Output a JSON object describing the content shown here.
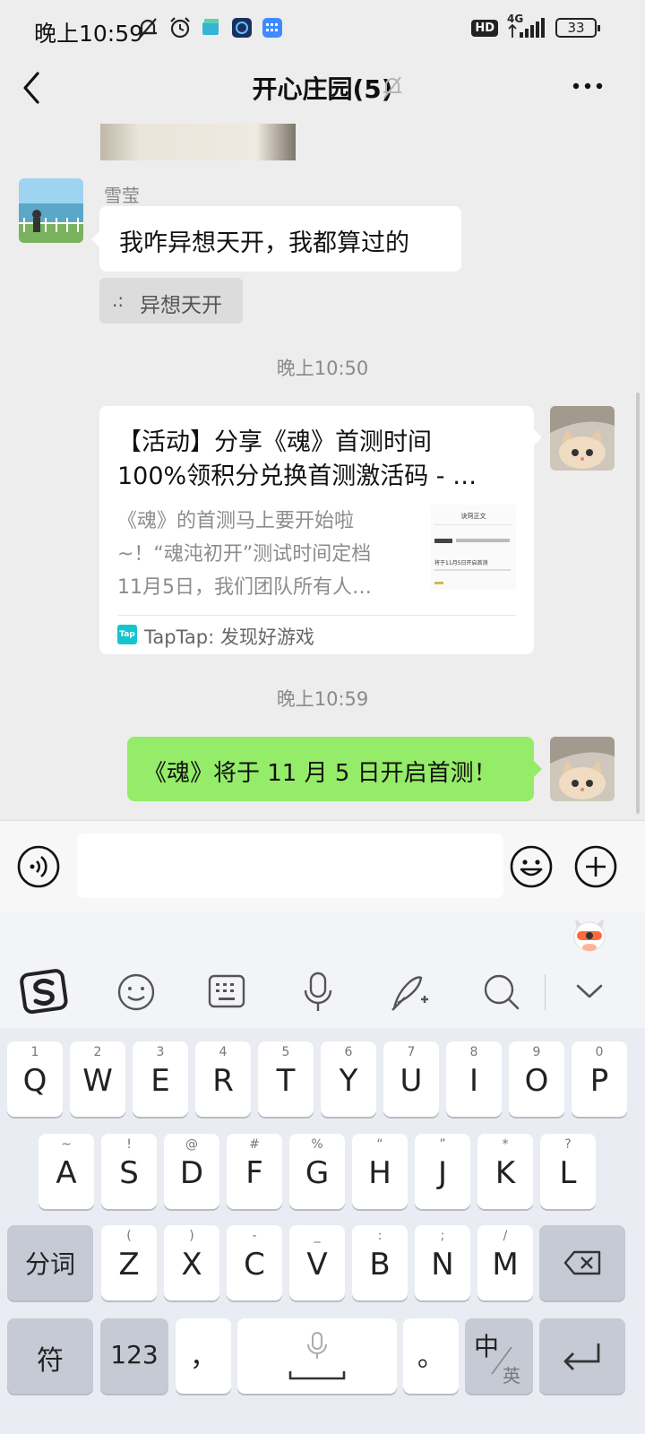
{
  "status_bar": {
    "time": "晚上10:59",
    "network": "4G",
    "hd": "HD",
    "battery": "33"
  },
  "nav": {
    "title": "开心庄园(5)"
  },
  "messages": {
    "sender_name": "雪莹",
    "text1": "我咋异想天开，我都算过的",
    "quote_prefix": ".:",
    "quote_text": "异想天开",
    "timestamp1": "晚上10:50",
    "link_title_line1": "【活动】分享《魂》首测时间",
    "link_title_line2": "100%领积分兑换首测激活码 - …",
    "link_desc_line1": "《魂》的首测马上要开始啦",
    "link_desc_line2": "~！“魂沌初开”测试时间定档",
    "link_desc_line3": "11月5日，我们团队所有人…",
    "link_thumb_heading": "诀窍正文",
    "link_thumb_line": "将于11月5日开启首测",
    "link_source_logo": "Tap",
    "link_source": "TapTap: 发现好游戏",
    "timestamp2": "晚上10:59",
    "text2": "《魂》将于 11 月 5 日开启首测！"
  },
  "keyboard": {
    "row1": [
      {
        "main": "Q",
        "sub": "1"
      },
      {
        "main": "W",
        "sub": "2"
      },
      {
        "main": "E",
        "sub": "3"
      },
      {
        "main": "R",
        "sub": "4"
      },
      {
        "main": "T",
        "sub": "5"
      },
      {
        "main": "Y",
        "sub": "6"
      },
      {
        "main": "U",
        "sub": "7"
      },
      {
        "main": "I",
        "sub": "8"
      },
      {
        "main": "O",
        "sub": "9"
      },
      {
        "main": "P",
        "sub": "0"
      }
    ],
    "row2": [
      {
        "main": "A",
        "sub": "~"
      },
      {
        "main": "S",
        "sub": "!"
      },
      {
        "main": "D",
        "sub": "@"
      },
      {
        "main": "F",
        "sub": "#"
      },
      {
        "main": "G",
        "sub": "%"
      },
      {
        "main": "H",
        "sub": "“"
      },
      {
        "main": "J",
        "sub": "”"
      },
      {
        "main": "K",
        "sub": "*"
      },
      {
        "main": "L",
        "sub": "?"
      }
    ],
    "row3": [
      {
        "main": "Z",
        "sub": "("
      },
      {
        "main": "X",
        "sub": ")"
      },
      {
        "main": "C",
        "sub": "-"
      },
      {
        "main": "V",
        "sub": "_"
      },
      {
        "main": "B",
        "sub": ":"
      },
      {
        "main": "N",
        "sub": ";"
      },
      {
        "main": "M",
        "sub": "/"
      }
    ],
    "fenci": "分词",
    "fu": "符",
    "num": "123",
    "comma": "，",
    "period": "。",
    "zh": "中",
    "en": "英"
  },
  "colors": {
    "sent_bubble": "#95ec69",
    "taptap": "#15c5ce"
  }
}
